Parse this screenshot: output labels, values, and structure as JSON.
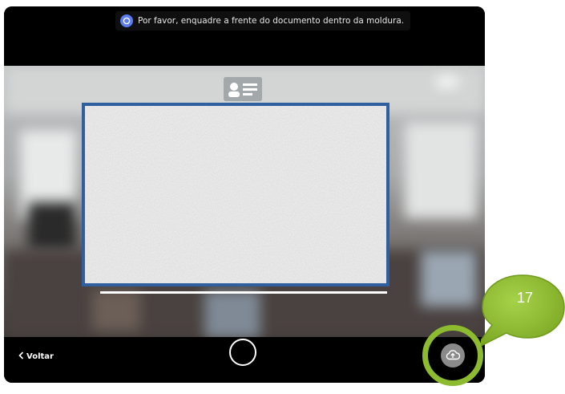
{
  "header": {
    "instruction": "Por favor, enquadre a frente do documento dentro da moldura.",
    "info_icon": "info-icon"
  },
  "camera": {
    "card_icon": "id-card-icon",
    "frame_color": "#2f5f9e"
  },
  "footer": {
    "back_label": "Voltar",
    "back_icon": "chevron-left-icon",
    "capture_icon": "shutter-icon",
    "upload_icon": "cloud-upload-icon"
  },
  "annotation": {
    "number": "17",
    "color": "#8dbb2f"
  }
}
